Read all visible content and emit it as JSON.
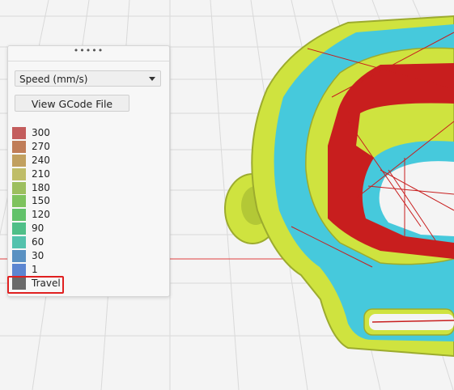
{
  "panel": {
    "grip": "•••••",
    "view_select": "Speed (mm/s)",
    "view_gcode_button": "View GCode File"
  },
  "legend": [
    {
      "label": "300",
      "color": "#c45d5d"
    },
    {
      "label": "270",
      "color": "#c07d58"
    },
    {
      "label": "240",
      "color": "#c1a05f"
    },
    {
      "label": "210",
      "color": "#bfbd68"
    },
    {
      "label": "180",
      "color": "#9dbf5f"
    },
    {
      "label": "150",
      "color": "#7ec35e"
    },
    {
      "label": "120",
      "color": "#62c26a"
    },
    {
      "label": "90",
      "color": "#4fbf88"
    },
    {
      "label": "60",
      "color": "#53c2ad"
    },
    {
      "label": "30",
      "color": "#5a91c2"
    },
    {
      "label": "1",
      "color": "#5c86d1"
    },
    {
      "label": "Travel",
      "color": "#6a6a6a"
    }
  ],
  "colors": {
    "background": "#f4f4f4",
    "model_yellow": "#cfe33f",
    "model_cyan": "#46c9dc",
    "travel_red": "#c81e1e",
    "highlight": "#e02020"
  }
}
